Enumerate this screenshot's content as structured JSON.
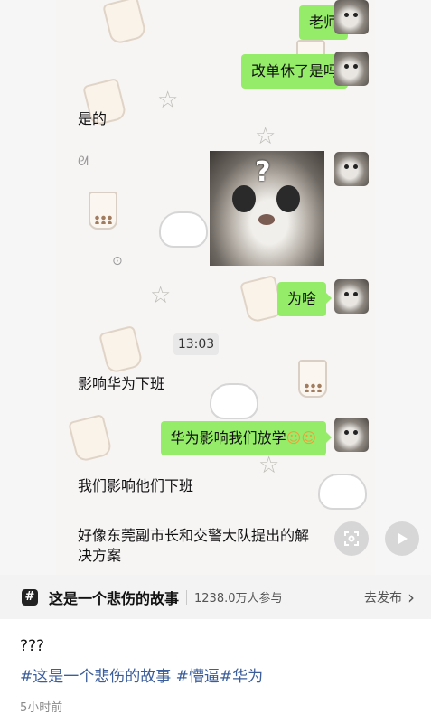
{
  "chat": {
    "messages": {
      "m1": "老师",
      "m2": "改单休了是吗",
      "m3": "是的",
      "m4": "为啥",
      "m5": "影响华为下班",
      "m6": "华为影响我们放学",
      "m6_emoji": "☺☺",
      "m7": "我们影响他们下班",
      "m8_line1": "好像东莞副市长和交警大队提出的解",
      "m8_line2": "决方案"
    },
    "timestamp": "13:03",
    "photo_overlay": "?"
  },
  "topic": {
    "icon_glyph": "#",
    "title": "这是一个悲伤的故事",
    "participants": "1238.0万人参与",
    "action": "去发布",
    "action_chevron": "›"
  },
  "caption": {
    "text": "???",
    "tag1": "#这是一个悲伤的故事",
    "tag2": "#懵逼",
    "tag3": "#华为",
    "time_ago": "5小时前"
  },
  "icons": [
    "lens-icon",
    "play-icon",
    "topic-hash-icon",
    "chevron-right-icon"
  ]
}
